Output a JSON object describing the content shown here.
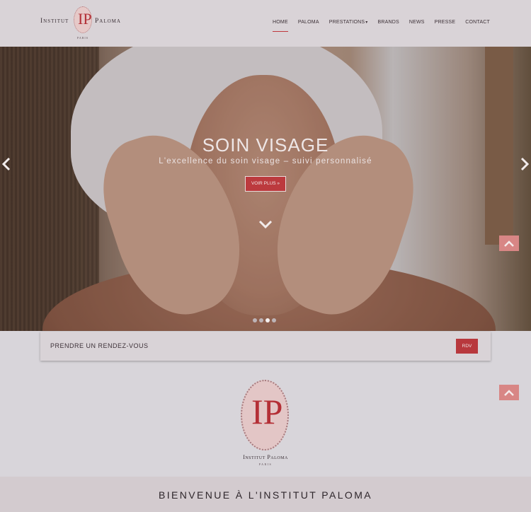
{
  "brand": {
    "word_left": "Institut",
    "word_right": "Paloma",
    "monogram": "IP",
    "city": "PARIS"
  },
  "nav": {
    "items": [
      {
        "label": "HOME",
        "active": true
      },
      {
        "label": "PALOMA"
      },
      {
        "label": "PRESTATIONS",
        "has_dropdown": true
      },
      {
        "label": "BRANDS"
      },
      {
        "label": "NEWS"
      },
      {
        "label": "PRESSE"
      },
      {
        "label": "CONTACT"
      }
    ]
  },
  "hero": {
    "title": "SOIN VISAGE",
    "subtitle": "L'excellence du soin visage – suivi personnalisé",
    "button_label": "VOIR PLUS »",
    "slide_count": 4,
    "active_slide": 3,
    "icons": [
      "chevron-left-icon",
      "chevron-right-icon",
      "chevron-down-icon"
    ]
  },
  "appointment": {
    "label": "PRENDRE UN RENDEZ-VOUS",
    "button_label": "RDV"
  },
  "big_logo": {
    "monogram": "IP",
    "name": "Institut Paloma",
    "city": "PARIS"
  },
  "welcome": {
    "title": "BIENVENUE À L'INSTITUT PALOMA"
  },
  "colors": {
    "accent": "#bc3a3e",
    "header_bg": "#d9d3d7",
    "page_bg": "#d8d5da",
    "scroll_top_button": "#d88685"
  }
}
